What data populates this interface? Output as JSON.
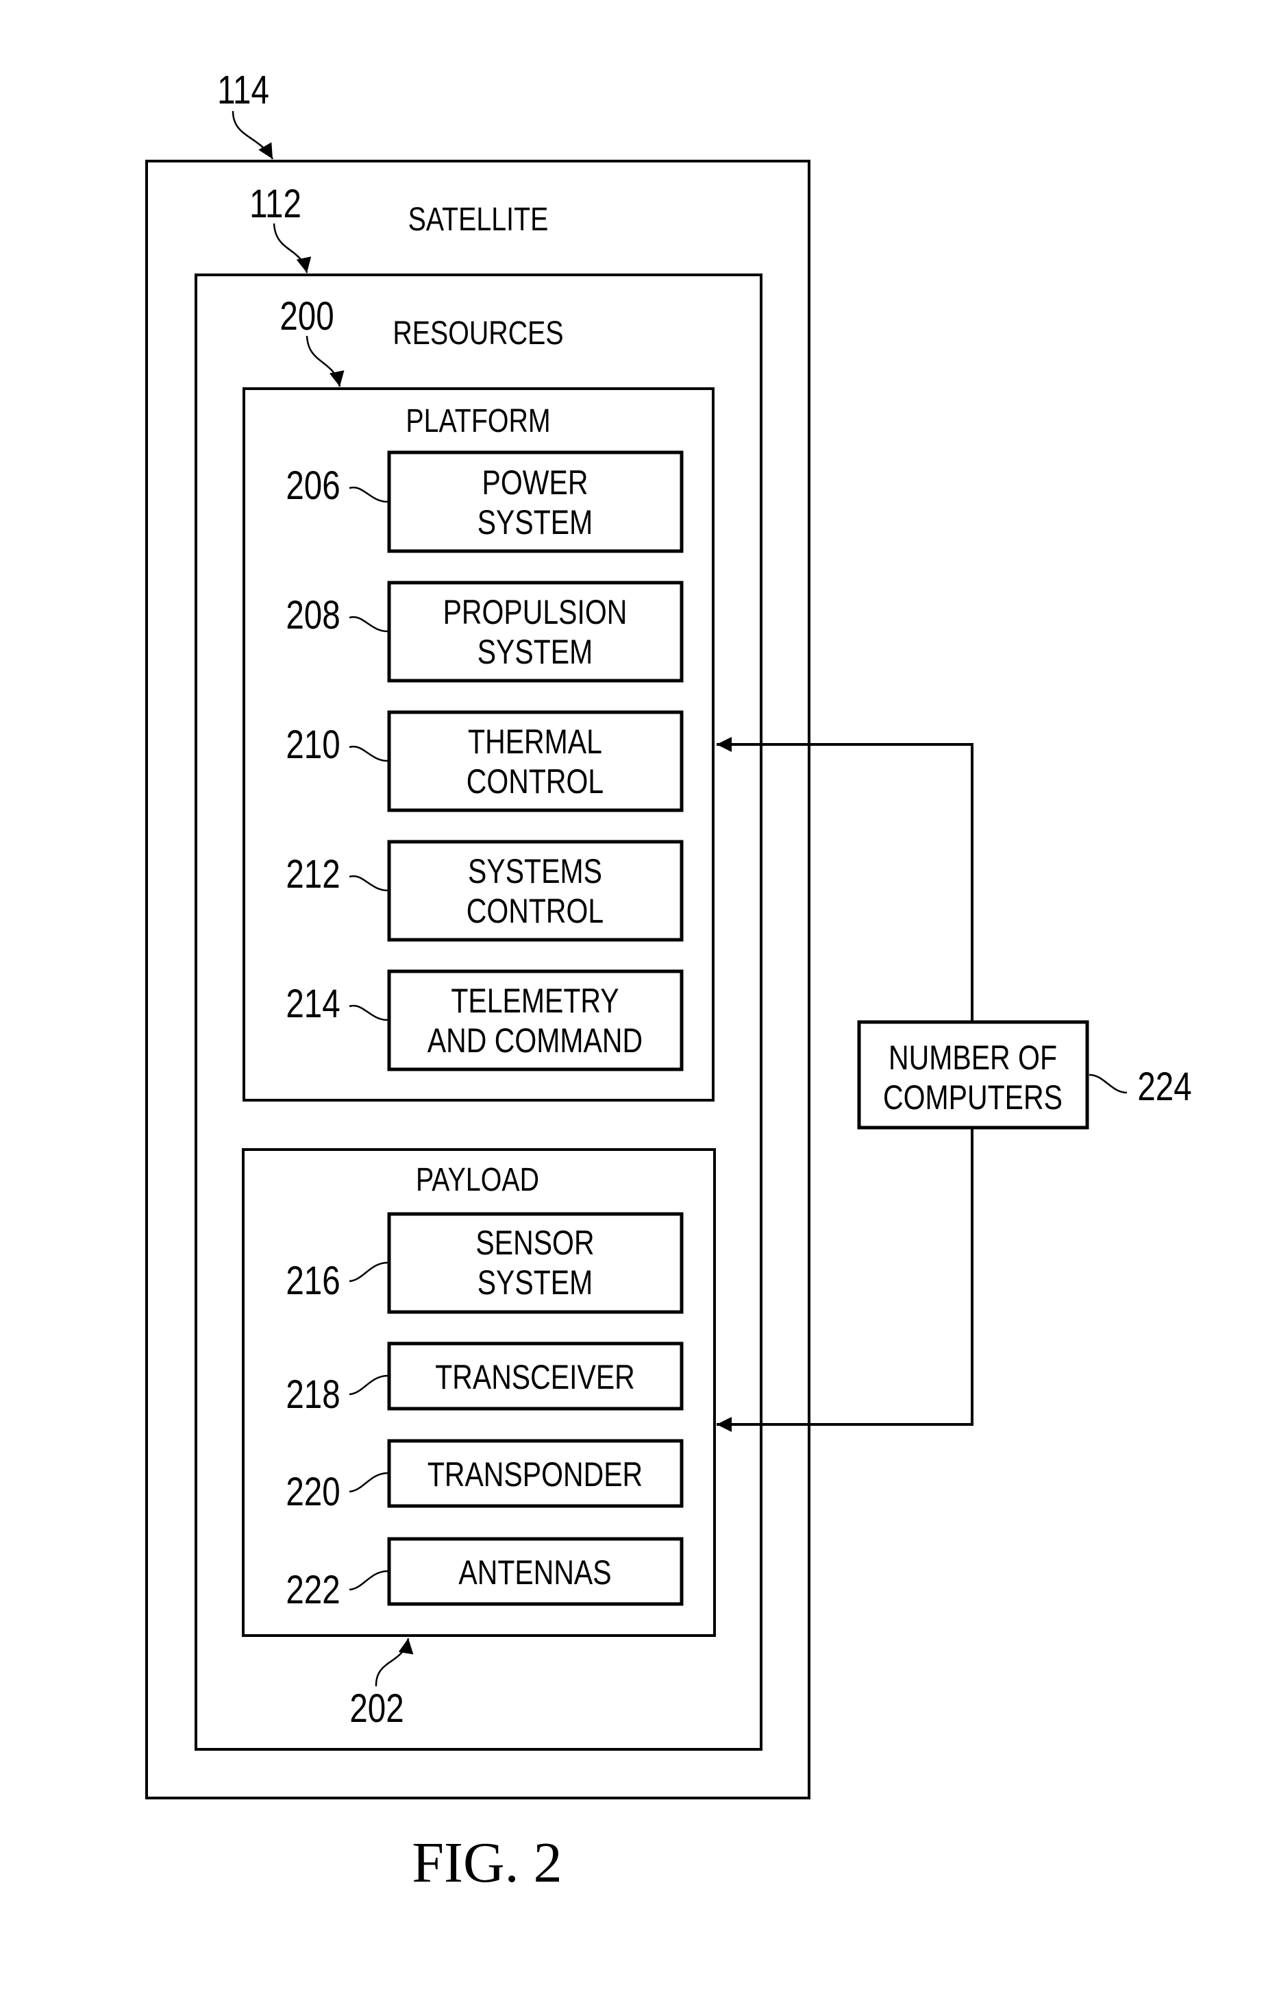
{
  "figure": {
    "caption": "FIG. 2",
    "colors": {
      "ink": "#000000",
      "paper": "#ffffff"
    }
  },
  "satellite": {
    "ref": "114",
    "label": "SATELLITE"
  },
  "resources": {
    "ref": "112",
    "label": "RESOURCES"
  },
  "platform": {
    "ref": "200",
    "label": "PLATFORM",
    "items": [
      {
        "ref": "206",
        "lines": [
          "POWER",
          "SYSTEM"
        ]
      },
      {
        "ref": "208",
        "lines": [
          "PROPULSION",
          "SYSTEM"
        ]
      },
      {
        "ref": "210",
        "lines": [
          "THERMAL",
          "CONTROL"
        ]
      },
      {
        "ref": "212",
        "lines": [
          "SYSTEMS",
          "CONTROL"
        ]
      },
      {
        "ref": "214",
        "lines": [
          "TELEMETRY",
          "AND COMMAND"
        ]
      }
    ]
  },
  "payload": {
    "ref": "202",
    "label": "PAYLOAD",
    "items": [
      {
        "ref": "216",
        "lines": [
          "SENSOR",
          "SYSTEM"
        ]
      },
      {
        "ref": "218",
        "lines": [
          "TRANSCEIVER"
        ]
      },
      {
        "ref": "220",
        "lines": [
          "TRANSPONDER"
        ]
      },
      {
        "ref": "222",
        "lines": [
          "ANTENNAS"
        ]
      }
    ]
  },
  "computers": {
    "ref": "224",
    "lines": [
      "NUMBER OF",
      "COMPUTERS"
    ]
  }
}
